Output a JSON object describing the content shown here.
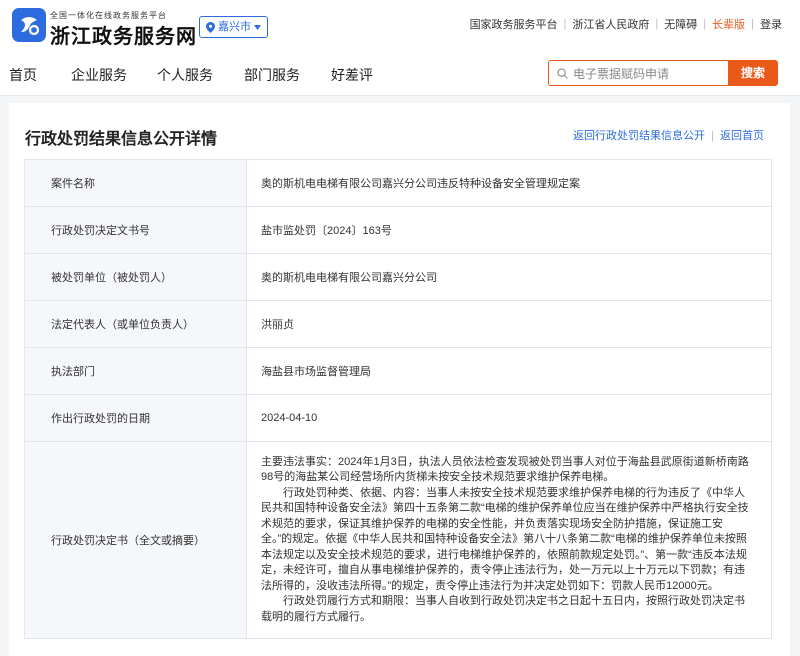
{
  "header": {
    "brand_sub": "全国一体化在线政务服务平台",
    "brand_main": "浙江政务服务网",
    "location": "嘉兴市",
    "top_links": [
      {
        "label": "国家政务服务平台",
        "highlight": false
      },
      {
        "label": "浙江省人民政府",
        "highlight": false
      },
      {
        "label": "无障碍",
        "highlight": false
      },
      {
        "label": "长辈版",
        "highlight": true
      },
      {
        "label": "登录",
        "highlight": false
      }
    ]
  },
  "nav": {
    "items": [
      "首页",
      "企业服务",
      "个人服务",
      "部门服务",
      "好差评"
    ],
    "search_placeholder": "电子票据赋码申请",
    "search_button": "搜索"
  },
  "page": {
    "title": "行政处罚结果信息公开详情",
    "back_link": "返回行政处罚结果信息公开",
    "home_link": "返回首页"
  },
  "detail": {
    "rows": [
      {
        "label": "案件名称",
        "value": "奥的斯机电电梯有限公司嘉兴分公司违反特种设备安全管理规定案"
      },
      {
        "label": "行政处罚决定文书号",
        "value": "盐市监处罚〔2024〕163号"
      },
      {
        "label": "被处罚单位（被处罚人）",
        "value": "奥的斯机电电梯有限公司嘉兴分公司"
      },
      {
        "label": "法定代表人（或单位负责人）",
        "value": "洪丽贞"
      },
      {
        "label": "执法部门",
        "value": "海盐县市场监督管理局"
      },
      {
        "label": "作出行政处罚的日期",
        "value": "2024-04-10"
      }
    ],
    "decision_label": "行政处罚决定书（全文或摘要）",
    "decision_paragraphs": [
      "主要违法事实：2024年1月3日，执法人员依法检查发现被处罚当事人对位于海盐县武原街道新桥南路98号的海盐某公司经营场所内货梯未按安全技术规范要求维护保养电梯。",
      "行政处罚种类、依据、内容：当事人未按安全技术规范要求维护保养电梯的行为违反了《中华人民共和国特种设备安全法》第四十五条第二款“电梯的维护保养单位应当在维护保养中严格执行安全技术规范的要求，保证其维护保养的电梯的安全性能，并负责落实现场安全防护措施，保证施工安全。”的规定。依据《中华人民共和国特种设备安全法》第八十八条第二款“电梯的维护保养单位未按照本法规定以及安全技术规范的要求，进行电梯维护保养的，依照前款规定处罚。”、第一款“违反本法规定，未经许可，擅自从事电梯维护保养的，责令停止违法行为，处一万元以上十万元以下罚款；有违法所得的，没收违法所得。”的规定，责令停止违法行为并决定处罚如下：罚款人民币12000元。",
      "行政处罚履行方式和期限：当事人自收到行政处罚决定书之日起十五日内，按照行政处罚决定书载明的履行方式履行。"
    ]
  },
  "colors": {
    "accent_blue": "#2d6cdf",
    "accent_orange": "#e8591a"
  },
  "icons": {
    "logo": "zhejiang-gov-logo",
    "location": "location-pin-icon",
    "dropdown": "caret-down-icon",
    "search": "search-icon"
  }
}
